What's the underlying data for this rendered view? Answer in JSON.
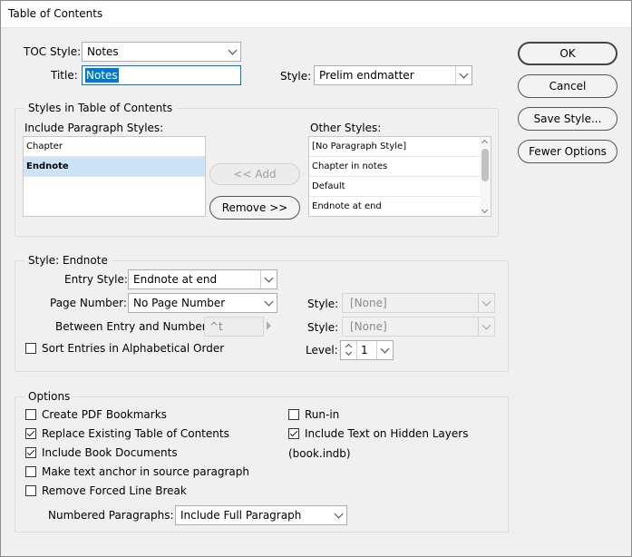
{
  "window": {
    "title": "Table of Contents"
  },
  "top": {
    "toc_style_label": "TOC Style:",
    "toc_style_value": "Notes",
    "title_label": "Title:",
    "title_value": "Notes",
    "style_label": "Style:",
    "style_value": "Prelim endmatter"
  },
  "buttons": {
    "ok": "OK",
    "cancel": "Cancel",
    "save_style": "Save Style...",
    "fewer_options": "Fewer Options"
  },
  "styles_group": {
    "title": "Styles in Table of Contents",
    "include_label": "Include Paragraph Styles:",
    "include_items": [
      "Chapter",
      "Endnote"
    ],
    "selected_include": "Endnote",
    "add_button": "<< Add",
    "remove_button": "Remove >>",
    "other_label": "Other Styles:",
    "other_items": [
      "[No Paragraph Style]",
      "Chapter in notes",
      "Default",
      "Endnote at end"
    ]
  },
  "style_endnote": {
    "title": "Style: Endnote",
    "entry_style_label": "Entry Style:",
    "entry_style_value": "Endnote at end",
    "page_number_label": "Page Number:",
    "page_number_value": "No Page Number",
    "page_style_label": "Style:",
    "page_style_value": "[None]",
    "between_label": "Between Entry and Number:",
    "between_value": "^t",
    "between_style_label": "Style:",
    "between_style_value": "[None]",
    "sort_label": "Sort Entries in Alphabetical Order",
    "sort_checked": false,
    "level_label": "Level:",
    "level_value": "1"
  },
  "options": {
    "title": "Options",
    "create_pdf_bookmarks": {
      "label": "Create PDF Bookmarks",
      "checked": false
    },
    "replace_existing": {
      "label": "Replace Existing Table of Contents",
      "checked": true
    },
    "include_book_docs": {
      "label": "Include Book Documents",
      "checked": true
    },
    "make_text_anchor": {
      "label": "Make text anchor in source paragraph",
      "checked": false
    },
    "remove_forced_break": {
      "label": "Remove Forced Line Break",
      "checked": false
    },
    "run_in": {
      "label": "Run-in",
      "checked": false
    },
    "include_hidden_layers": {
      "label": "Include Text on Hidden Layers",
      "checked": true
    },
    "book_name": "(book.indb)",
    "numbered_paragraphs_label": "Numbered Paragraphs:",
    "numbered_paragraphs_value": "Include Full Paragraph"
  },
  "colors": {
    "accent": "#0078d7",
    "selection": "#cce4f7"
  }
}
